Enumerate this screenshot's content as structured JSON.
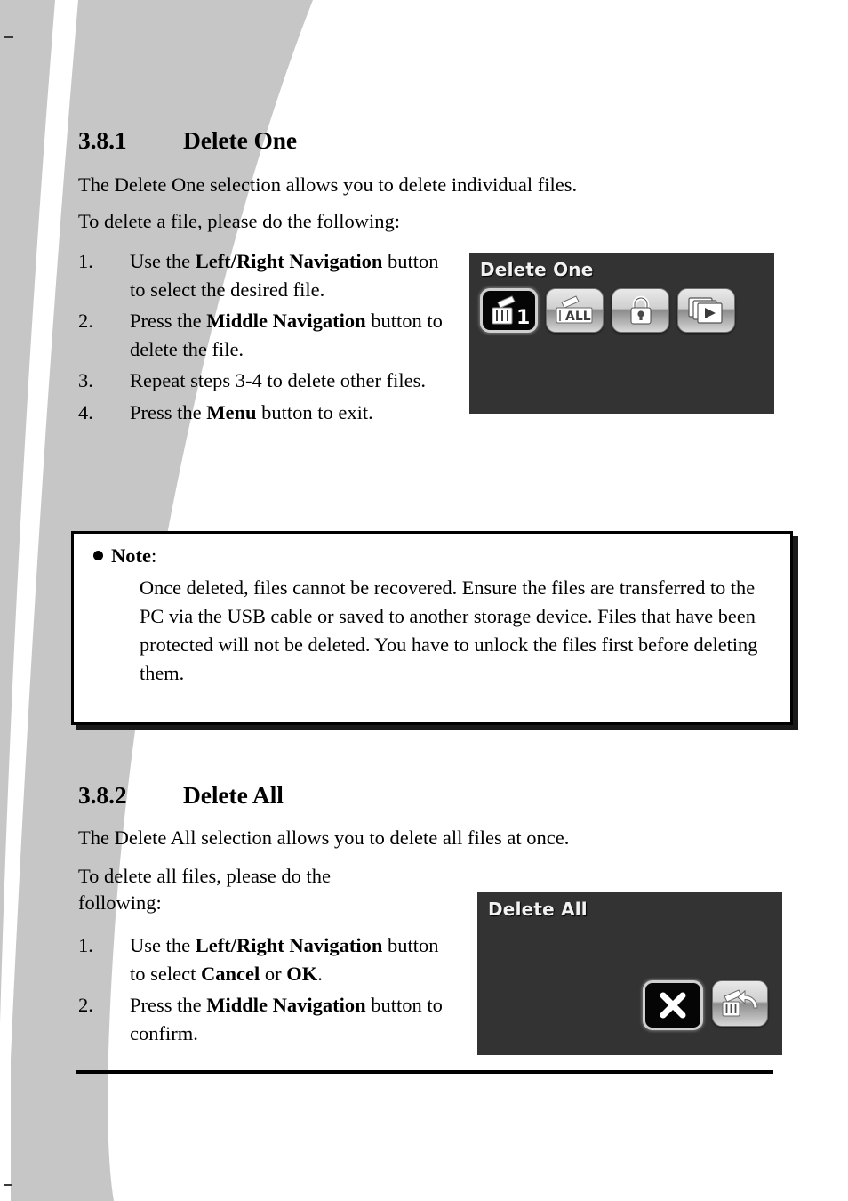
{
  "page": {
    "background_color": "#ffffff",
    "decoration_color": "#c6c6c6"
  },
  "sections": [
    {
      "number": "3.8.1",
      "title": "Delete One",
      "intro": "The Delete One selection allows you to delete individual files.",
      "lead_in": "To delete a file, please do the following:",
      "steps": [
        {
          "marker": "1.",
          "parts": [
            {
              "text": "Use the ",
              "bold": false
            },
            {
              "text": "Left/Right Navigation",
              "bold": true
            },
            {
              "text": " button to select the desired file.",
              "bold": false
            }
          ]
        },
        {
          "marker": "2.",
          "parts": [
            {
              "text": "Press the ",
              "bold": false
            },
            {
              "text": "Middle Navigation",
              "bold": true
            },
            {
              "text": " button to delete the file.",
              "bold": false
            }
          ]
        },
        {
          "marker": "3.",
          "parts": [
            {
              "text": "Repeat steps 3-4 to delete other files.",
              "bold": false
            }
          ]
        },
        {
          "marker": "4.",
          "parts": [
            {
              "text": "Press the ",
              "bold": false
            },
            {
              "text": "Menu",
              "bold": true
            },
            {
              "text": " button to exit.",
              "bold": false
            }
          ]
        }
      ]
    },
    {
      "number": "3.8.2",
      "title": "Delete All",
      "intro": "The Delete All selection allows you to delete all files at once.",
      "lead_in": "To delete all files, please do the\nfollowing:",
      "steps": [
        {
          "marker": "1.",
          "parts": [
            {
              "text": "Use the ",
              "bold": false
            },
            {
              "text": "Left/Right Navigation",
              "bold": true
            },
            {
              "text": " button to select ",
              "bold": false
            },
            {
              "text": "Cancel",
              "bold": true
            },
            {
              "text": " or ",
              "bold": false
            },
            {
              "text": "OK",
              "bold": true
            },
            {
              "text": ".",
              "bold": false
            }
          ]
        },
        {
          "marker": "2.",
          "parts": [
            {
              "text": "Press the ",
              "bold": false
            },
            {
              "text": "Middle Navigation",
              "bold": true
            },
            {
              "text": " button to confirm.",
              "bold": false
            }
          ]
        }
      ]
    }
  ],
  "note": {
    "bullet": "●",
    "label": "Note",
    "colon": ":",
    "body": "Once deleted, files cannot be recovered. Ensure the files are transferred to the PC via the USB cable or saved to another storage device. Files that have been protected will not be deleted. You have to unlock the files first before deleting them."
  },
  "device_screens": [
    {
      "id": "delete-one",
      "title": "Delete One",
      "background_color": "#333333",
      "title_color": "#f2f2f2",
      "icons": [
        {
          "name": "delete-one-icon",
          "label": "1",
          "selected": true
        },
        {
          "name": "delete-all-icon",
          "label": "ALL",
          "selected": false
        },
        {
          "name": "lock-icon",
          "label": "",
          "selected": false
        },
        {
          "name": "slideshow-icon",
          "label": "",
          "selected": false
        }
      ]
    },
    {
      "id": "delete-all",
      "title": "Delete All",
      "background_color": "#333333",
      "title_color": "#f2f2f2",
      "icons": [
        {
          "name": "cancel-x-icon",
          "label": "",
          "selected": true
        },
        {
          "name": "confirm-trash-icon",
          "label": "",
          "selected": false
        }
      ]
    }
  ]
}
